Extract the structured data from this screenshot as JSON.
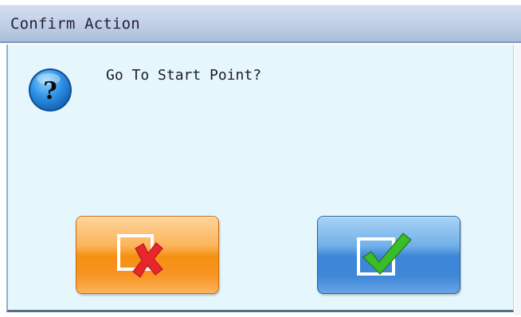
{
  "dialog": {
    "title": "Confirm Action",
    "message": "Go To Start Point?",
    "icon": "question-icon"
  },
  "buttons": {
    "cancel": {
      "icon": "x-cross-icon"
    },
    "ok": {
      "icon": "checkmark-icon"
    }
  },
  "colors": {
    "title_bar": "#c2d0e8",
    "body": "#e5f7fd",
    "cancel_button": "#f59012",
    "ok_button": "#3d85d7",
    "cross": "#e8262c",
    "check": "#3bbc2a"
  }
}
